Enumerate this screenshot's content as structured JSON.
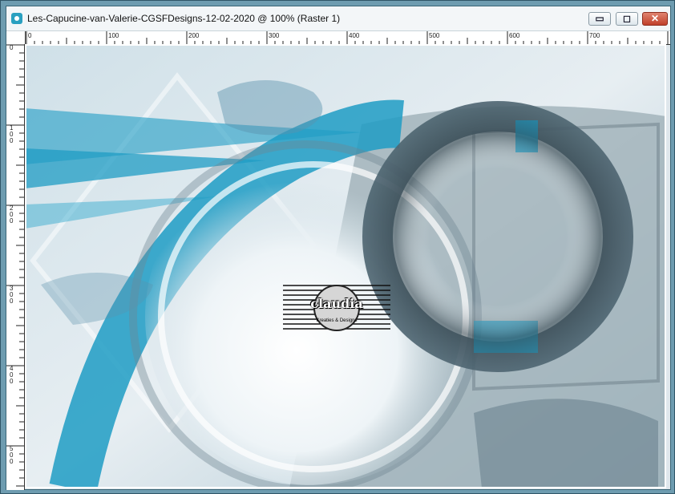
{
  "window": {
    "title": "Les-Capucine-van-Valerie-CGSFDesigns-12-02-2020 @ 100% (Raster 1)",
    "minimize_icon": "minimize-icon",
    "maximize_icon": "maximize-icon",
    "close_icon": "close-icon"
  },
  "ruler_top": {
    "labels": [
      "0",
      "100",
      "200",
      "300",
      "400",
      "500",
      "600",
      "700"
    ]
  },
  "ruler_left": {
    "labels": [
      "0",
      "100",
      "200",
      "300",
      "400",
      "500"
    ]
  },
  "canvas": {
    "watermark_text": "claudia",
    "watermark_subtext": "Kreaties & Designs"
  },
  "colors": {
    "accent_blue": "#1f9cc4",
    "dark_slate": "#4f6672",
    "pale_bg": "#dbe7ee"
  }
}
